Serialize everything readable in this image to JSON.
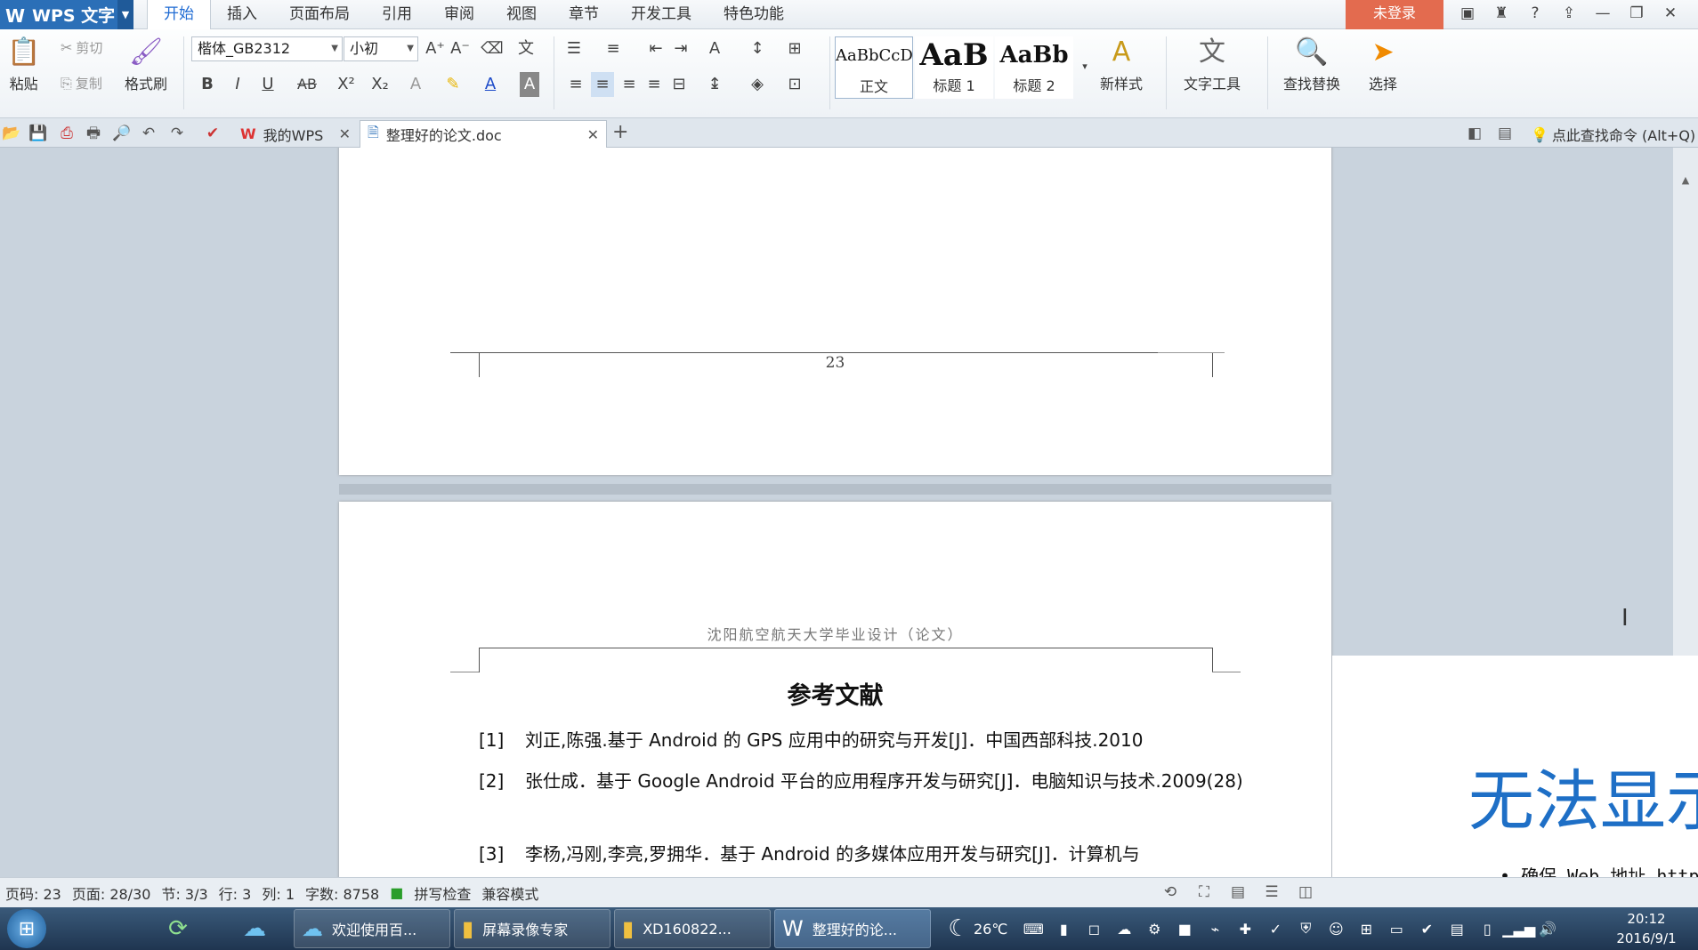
{
  "app": {
    "name": "WPS 文字",
    "login_label": "未登录"
  },
  "menu_tabs": [
    "开始",
    "插入",
    "页面布局",
    "引用",
    "审阅",
    "视图",
    "章节",
    "开发工具",
    "特色功能"
  ],
  "ribbon": {
    "paste": "粘贴",
    "cut": "剪切",
    "copy": "复制",
    "format_painter": "格式刷",
    "font_name": "楷体_GB2312",
    "font_size": "小初",
    "bold": "B",
    "italic": "I",
    "underline": "U",
    "strikethrough": "AB",
    "superscript": "X²",
    "subscript": "X₂",
    "styles": [
      {
        "sample": "AaBbCcD",
        "name": "正文"
      },
      {
        "sample": "AaB",
        "name": "标题 1"
      },
      {
        "sample": "AaBb",
        "name": "标题 2"
      }
    ],
    "new_style": "新样式",
    "text_tools": "文字工具",
    "find_replace": "查找替换",
    "select": "选择"
  },
  "tabs": {
    "mywps": "我的WPS",
    "doc": "整理好的论文.doc",
    "search_cmd": "点此查找命令 (Alt+Q)"
  },
  "document": {
    "page_number": "23",
    "page_header": "沈阳航空航天大学毕业设计（论文）",
    "references_title": "参考文献",
    "references": [
      {
        "num": "[1]",
        "text": "刘正,陈强.基于 Android 的 GPS 应用中的研究与开发[J]．中国西部科技.2010"
      },
      {
        "num": "[2]",
        "text": "张仕成．基于 Google Android 平台的应用程序开发与研究[J]．电脑知识与技术.2009(28)"
      },
      {
        "num": "[3]",
        "text": "李杨,冯刚,李亮,罗拥华．基于 Android 的多媒体应用开发与研究[J]．计算机与"
      }
    ]
  },
  "overlay": {
    "big_text": "无法显示",
    "bullet_text": "• 确保 Web 地址 http"
  },
  "statusbar": {
    "page_code": "页码: 23",
    "page": "页面: 28/30",
    "section": "节: 3/3",
    "row": "行: 3",
    "col": "列: 1",
    "word_count": "字数: 8758",
    "spell_check": "拼写检查",
    "compat_mode": "兼容模式"
  },
  "taskbar": {
    "tasks": [
      "欢迎使用百...",
      "屏幕录像专家",
      "XD160822...",
      "整理好的论..."
    ],
    "temperature": "26℃",
    "time": "20:12",
    "date": "2016/9/1"
  },
  "colors": {
    "app_blue": "#2b6fb7",
    "login_red": "#e36b4f",
    "overlay_blue": "#1e6fc6"
  }
}
